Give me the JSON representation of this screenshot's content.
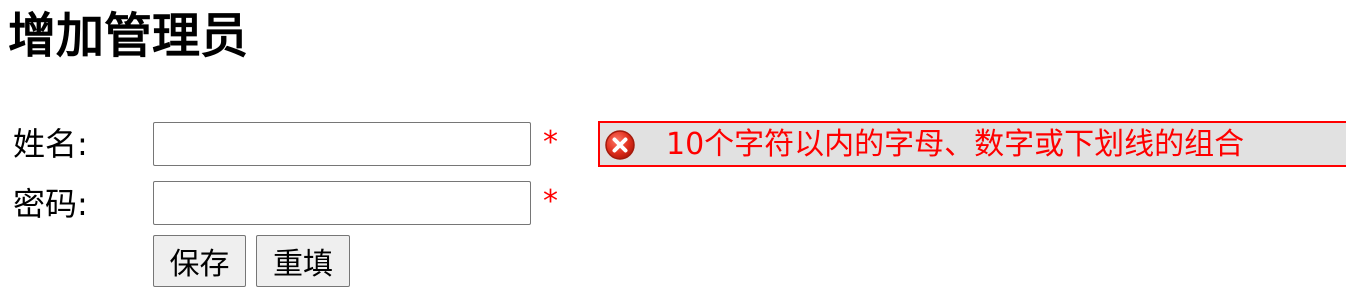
{
  "page": {
    "title": "增加管理员"
  },
  "form": {
    "name_label": "姓名:",
    "name_value": "",
    "password_label": "密码:",
    "password_value": "",
    "required_mark": "*",
    "name_error": "10个字符以内的字母、数字或下划线的组合",
    "save_label": "保存",
    "reset_label": "重填"
  },
  "colors": {
    "error": "#ff0000",
    "tip_background": "#e1e1e1",
    "button_background": "#efefef"
  },
  "icons": {
    "error_tip": "error-circle-x-icon"
  }
}
